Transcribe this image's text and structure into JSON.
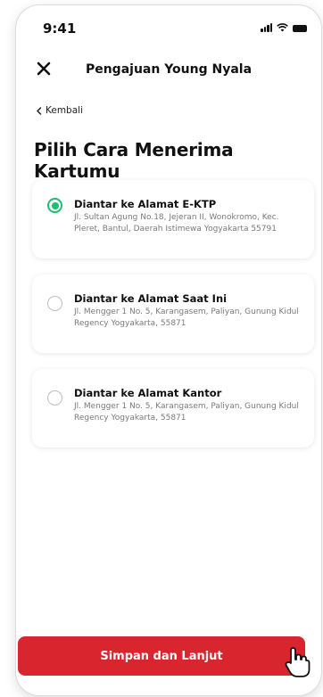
{
  "status_bar": {
    "time": "9:41"
  },
  "header": {
    "title": "Pengajuan Young Nyala",
    "close_icon": "close-icon"
  },
  "back": {
    "label": "Kembali",
    "icon": "chevron-left-icon"
  },
  "page": {
    "title": "Pilih Cara Menerima Kartumu"
  },
  "options": [
    {
      "title": "Diantar ke Alamat E-KTP",
      "address": "Jl. Sultan Agung No.18, Jejeran II, Wonokromo, Kec. Pleret, Bantul, Daerah Istimewa Yogyakarta 55791",
      "selected": true
    },
    {
      "title": "Diantar ke Alamat Saat Ini",
      "address": "Jl. Mengger 1 No. 5, Karangasem, Paliyan, Gunung Kidul Regency Yogyakarta, 55871",
      "selected": false
    },
    {
      "title": "Diantar ke Alamat Kantor",
      "address": "Jl. Mengger 1 No. 5, Karangasem, Paliyan, Gunung Kidul Regency Yogyakarta, 55871",
      "selected": false
    }
  ],
  "footer": {
    "submit_label": "Simpan dan Lanjut"
  },
  "colors": {
    "primary": "#d9252e",
    "radio_selected": "#1cbf6d",
    "muted_text": "#7a7a7a"
  }
}
